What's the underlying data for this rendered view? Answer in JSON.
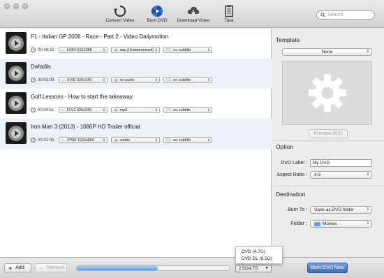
{
  "toolbar": {
    "convert_label": "Convert Video",
    "burn_label": "Burn DVD",
    "download_label": "Download Video",
    "task_label": "Task",
    "search_placeholder": "Search"
  },
  "videos": [
    {
      "title": "F1 - Italian GP 2008 - Race - Part 2 - Video Dailymotion",
      "duration": "00:48:32",
      "video": "H264 512x288",
      "audio": "aac (Undetermined)",
      "subtitle": "no subtitle"
    },
    {
      "title": "Dafodils",
      "duration": "00:03:09",
      "video": "XVID 320x240",
      "audio": "no audio",
      "subtitle": "no subtitle"
    },
    {
      "title": "Golf Lessons - How to start the takeaway",
      "duration": "00:04:51",
      "video": "FLV1 426x240",
      "audio": "mp3",
      "subtitle": "no subtitle"
    },
    {
      "title": "Iron Man 3 (2013) - 1080P HD Trailer official",
      "duration": "00:02:05",
      "video": "VP80 1920x800",
      "audio": "vorbis",
      "subtitle": "no subtitle"
    }
  ],
  "subtitle_prefix": "CC",
  "template": {
    "heading": "Template",
    "selected": "None",
    "preview_button": "Preview DVD"
  },
  "option": {
    "heading": "Option",
    "dvd_label_label": "DVD Label :",
    "dvd_label_value": "My DVD",
    "aspect_ratio_label": "Aspect Ratio :",
    "aspect_ratio_value": "4:3"
  },
  "destination": {
    "heading": "Destination",
    "burn_to_label": "Burn To :",
    "burn_to_value": "Save as DVD folder",
    "folder_label": "Folder :",
    "folder_value": "Movies"
  },
  "bottom": {
    "add_label": "Add",
    "remove_label": "Remove",
    "progress_fraction": 0.53,
    "size_value": "2.5G/4.7G",
    "burn_button": "Burn DVD Now"
  },
  "size_menu": {
    "options": [
      "DVD (4.7G)",
      "DVD DL (8.5G)"
    ]
  },
  "colors": {
    "accent": "#3e6ab6",
    "row_alt": "#edf2f9",
    "progress": "#5b9be0"
  }
}
